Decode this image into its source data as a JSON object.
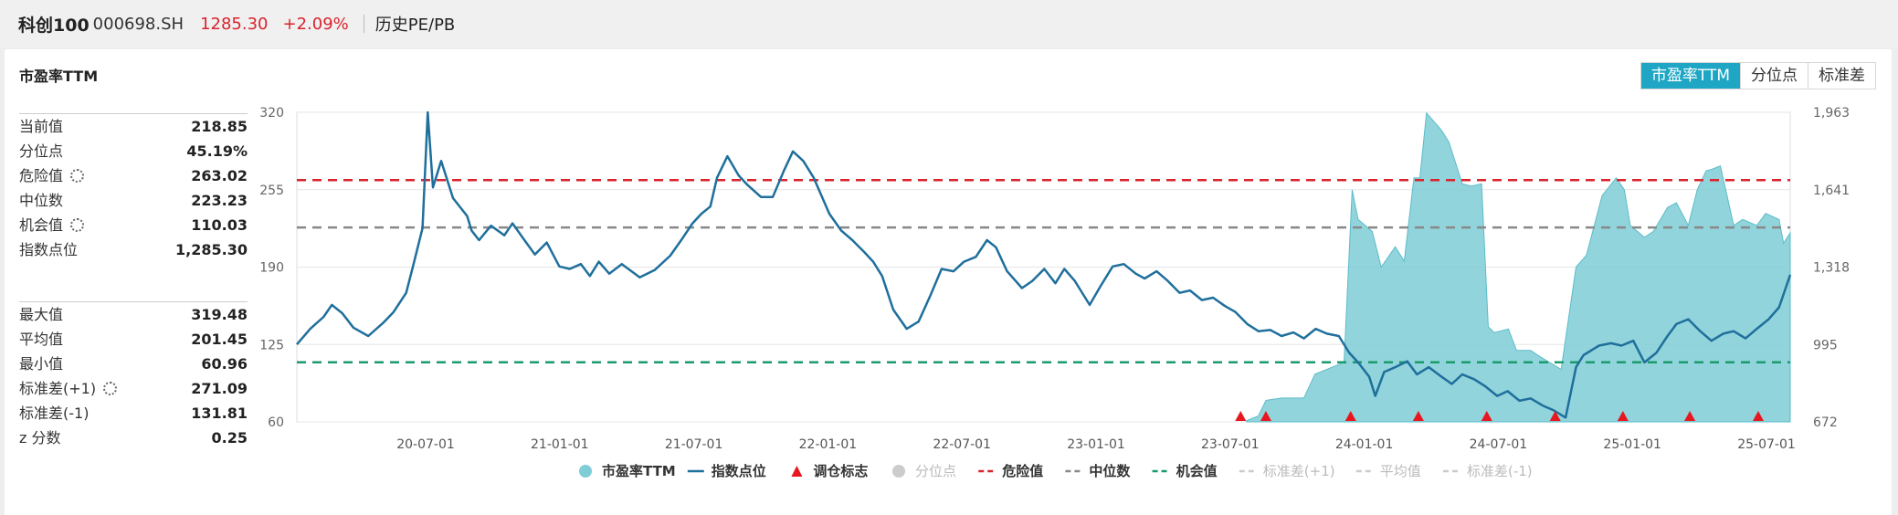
{
  "header": {
    "name": "科创100",
    "code": "000698.SH",
    "price": "1285.30",
    "change": "+2.09%",
    "tab": "历史PE/PB"
  },
  "panel": {
    "title": "市盈率TTM",
    "toggle": [
      "市盈率TTM",
      "分位点",
      "标准差"
    ],
    "active_toggle": 0
  },
  "stats_top": [
    {
      "label": "当前值",
      "value": "218.85",
      "gear": false
    },
    {
      "label": "分位点",
      "value": "45.19%",
      "gear": false
    },
    {
      "label": "危险值",
      "value": "263.02",
      "gear": true
    },
    {
      "label": "中位数",
      "value": "223.23",
      "gear": false
    },
    {
      "label": "机会值",
      "value": "110.03",
      "gear": true
    },
    {
      "label": "指数点位",
      "value": "1,285.30",
      "gear": false
    }
  ],
  "stats_bottom": [
    {
      "label": "最大值",
      "value": "319.48",
      "gear": false
    },
    {
      "label": "平均值",
      "value": "201.45",
      "gear": false
    },
    {
      "label": "最小值",
      "value": "60.96",
      "gear": false
    },
    {
      "label": "标准差(+1)",
      "value": "271.09",
      "gear": true
    },
    {
      "label": "标准差(-1)",
      "value": "131.81",
      "gear": false
    },
    {
      "label": "z 分数",
      "value": "0.25",
      "gear": false
    }
  ],
  "colors": {
    "pe_fill": "#7fcdd6",
    "pe_line": "#5bbcc9",
    "index_line": "#1f6f9c",
    "danger": "#d9232d",
    "median": "#888888",
    "opportunity": "#1a9b6c",
    "marker": "#e8161e",
    "grid": "#e6e6e6"
  },
  "chart_data": {
    "type": "line",
    "x_tick_labels": [
      "20-07-01",
      "21-01-01",
      "21-07-01",
      "22-01-01",
      "22-07-01",
      "23-01-01",
      "23-07-01",
      "24-01-01",
      "24-07-01",
      "25-01-01",
      "25-07-01"
    ],
    "y_left_ticks": [
      "320",
      "255",
      "190",
      "125",
      "60"
    ],
    "y_left_lim": [
      60,
      320
    ],
    "y_right_ticks": [
      "1,963",
      "1,641",
      "1,318",
      "995",
      "672"
    ],
    "y_right_lim": [
      672,
      1963
    ],
    "x_range": [
      "2020-01-23",
      "2025-07-23"
    ],
    "ref_lines": [
      {
        "name": "危险值",
        "value": 263.02
      },
      {
        "name": "中位数",
        "value": 223.23
      },
      {
        "name": "机会值",
        "value": 110.03
      }
    ],
    "pe_series": {
      "name": "市盈率TTM",
      "points": [
        [
          "2023-07-23",
          60.96
        ],
        [
          "2023-08-08",
          65
        ],
        [
          "2023-08-18",
          78
        ],
        [
          "2023-09-08",
          80
        ],
        [
          "2023-10-08",
          80
        ],
        [
          "2023-10-23",
          100
        ],
        [
          "2023-12-01",
          110
        ],
        [
          "2023-12-12",
          255
        ],
        [
          "2023-12-20",
          230
        ],
        [
          "2024-01-08",
          220
        ],
        [
          "2024-01-20",
          190
        ],
        [
          "2024-02-08",
          207
        ],
        [
          "2024-02-20",
          195
        ],
        [
          "2024-03-04",
          265
        ],
        [
          "2024-03-12",
          265
        ],
        [
          "2024-03-21",
          319.48
        ],
        [
          "2024-04-10",
          305
        ],
        [
          "2024-04-20",
          295
        ],
        [
          "2024-05-08",
          260
        ],
        [
          "2024-05-20",
          258
        ],
        [
          "2024-06-03",
          260
        ],
        [
          "2024-06-12",
          140
        ],
        [
          "2024-06-20",
          135
        ],
        [
          "2024-07-09",
          138
        ],
        [
          "2024-07-20",
          120
        ],
        [
          "2024-08-08",
          120
        ],
        [
          "2024-08-20",
          115
        ],
        [
          "2024-09-18",
          104
        ],
        [
          "2024-10-08",
          190
        ],
        [
          "2024-10-22",
          200
        ],
        [
          "2024-11-12",
          250
        ],
        [
          "2024-12-01",
          265
        ],
        [
          "2024-12-12",
          255
        ],
        [
          "2024-12-20",
          225
        ],
        [
          "2025-01-08",
          215
        ],
        [
          "2025-01-20",
          220
        ],
        [
          "2025-02-08",
          240
        ],
        [
          "2025-02-20",
          244
        ],
        [
          "2025-03-08",
          225
        ],
        [
          "2025-03-20",
          255
        ],
        [
          "2025-04-01",
          271
        ],
        [
          "2025-04-08",
          272
        ],
        [
          "2025-04-20",
          275
        ],
        [
          "2025-05-08",
          225
        ],
        [
          "2025-05-20",
          230
        ],
        [
          "2025-06-08",
          225
        ],
        [
          "2025-06-20",
          235
        ],
        [
          "2025-07-08",
          230
        ],
        [
          "2025-07-14",
          210
        ],
        [
          "2025-07-23",
          218.85
        ]
      ]
    },
    "index_series": {
      "name": "指数点位",
      "points": [
        [
          "2020-01-23",
          995
        ],
        [
          "2020-02-10",
          1060
        ],
        [
          "2020-02-28",
          1110
        ],
        [
          "2020-03-10",
          1160
        ],
        [
          "2020-03-24",
          1125
        ],
        [
          "2020-04-08",
          1065
        ],
        [
          "2020-04-28",
          1030
        ],
        [
          "2020-05-18",
          1085
        ],
        [
          "2020-06-01",
          1130
        ],
        [
          "2020-06-18",
          1210
        ],
        [
          "2020-06-28",
          1330
        ],
        [
          "2020-07-10",
          1480
        ],
        [
          "2020-07-17",
          1963
        ],
        [
          "2020-07-24",
          1650
        ],
        [
          "2020-08-04",
          1760
        ],
        [
          "2020-08-20",
          1605
        ],
        [
          "2020-09-08",
          1530
        ],
        [
          "2020-09-14",
          1470
        ],
        [
          "2020-09-24",
          1430
        ],
        [
          "2020-10-10",
          1490
        ],
        [
          "2020-10-28",
          1450
        ],
        [
          "2020-11-08",
          1500
        ],
        [
          "2020-11-24",
          1430
        ],
        [
          "2020-12-08",
          1370
        ],
        [
          "2020-12-24",
          1420
        ],
        [
          "2021-01-10",
          1320
        ],
        [
          "2021-01-24",
          1310
        ],
        [
          "2021-02-08",
          1330
        ],
        [
          "2021-02-20",
          1280
        ],
        [
          "2021-03-04",
          1340
        ],
        [
          "2021-03-18",
          1290
        ],
        [
          "2021-04-04",
          1330
        ],
        [
          "2021-04-28",
          1275
        ],
        [
          "2021-05-18",
          1305
        ],
        [
          "2021-06-08",
          1365
        ],
        [
          "2021-06-24",
          1435
        ],
        [
          "2021-07-08",
          1500
        ],
        [
          "2021-07-20",
          1540
        ],
        [
          "2021-08-01",
          1570
        ],
        [
          "2021-08-10",
          1690
        ],
        [
          "2021-08-24",
          1780
        ],
        [
          "2021-09-08",
          1700
        ],
        [
          "2021-09-20",
          1660
        ],
        [
          "2021-10-08",
          1610
        ],
        [
          "2021-10-24",
          1610
        ],
        [
          "2021-11-08",
          1720
        ],
        [
          "2021-11-20",
          1800
        ],
        [
          "2021-12-04",
          1760
        ],
        [
          "2021-12-18",
          1690
        ],
        [
          "2022-01-08",
          1540
        ],
        [
          "2022-01-24",
          1470
        ],
        [
          "2022-02-08",
          1430
        ],
        [
          "2022-02-24",
          1380
        ],
        [
          "2022-03-08",
          1340
        ],
        [
          "2022-03-20",
          1280
        ],
        [
          "2022-04-04",
          1140
        ],
        [
          "2022-04-22",
          1060
        ],
        [
          "2022-05-08",
          1090
        ],
        [
          "2022-05-24",
          1200
        ],
        [
          "2022-06-08",
          1310
        ],
        [
          "2022-06-24",
          1300
        ],
        [
          "2022-07-08",
          1340
        ],
        [
          "2022-07-24",
          1360
        ],
        [
          "2022-08-08",
          1430
        ],
        [
          "2022-08-20",
          1400
        ],
        [
          "2022-09-04",
          1300
        ],
        [
          "2022-09-24",
          1230
        ],
        [
          "2022-10-08",
          1260
        ],
        [
          "2022-10-24",
          1310
        ],
        [
          "2022-11-08",
          1250
        ],
        [
          "2022-11-20",
          1310
        ],
        [
          "2022-12-04",
          1260
        ],
        [
          "2022-12-24",
          1160
        ],
        [
          "2023-01-08",
          1240
        ],
        [
          "2023-01-24",
          1320
        ],
        [
          "2023-02-08",
          1330
        ],
        [
          "2023-02-24",
          1290
        ],
        [
          "2023-03-08",
          1270
        ],
        [
          "2023-03-24",
          1300
        ],
        [
          "2023-04-08",
          1260
        ],
        [
          "2023-04-24",
          1210
        ],
        [
          "2023-05-08",
          1220
        ],
        [
          "2023-05-24",
          1180
        ],
        [
          "2023-06-08",
          1190
        ],
        [
          "2023-06-24",
          1155
        ],
        [
          "2023-07-08",
          1130
        ],
        [
          "2023-07-24",
          1080
        ],
        [
          "2023-08-08",
          1050
        ],
        [
          "2023-08-24",
          1055
        ],
        [
          "2023-09-08",
          1030
        ],
        [
          "2023-09-24",
          1045
        ],
        [
          "2023-10-08",
          1020
        ],
        [
          "2023-10-24",
          1060
        ],
        [
          "2023-11-08",
          1040
        ],
        [
          "2023-11-24",
          1030
        ],
        [
          "2023-12-08",
          960
        ],
        [
          "2023-12-20",
          920
        ],
        [
          "2024-01-04",
          860
        ],
        [
          "2024-01-12",
          780
        ],
        [
          "2024-01-24",
          880
        ],
        [
          "2024-02-08",
          900
        ],
        [
          "2024-02-24",
          925
        ],
        [
          "2024-03-08",
          870
        ],
        [
          "2024-03-24",
          900
        ],
        [
          "2024-04-08",
          865
        ],
        [
          "2024-04-24",
          830
        ],
        [
          "2024-05-08",
          870
        ],
        [
          "2024-05-24",
          850
        ],
        [
          "2024-06-08",
          820
        ],
        [
          "2024-06-24",
          780
        ],
        [
          "2024-07-08",
          800
        ],
        [
          "2024-07-24",
          760
        ],
        [
          "2024-08-08",
          770
        ],
        [
          "2024-08-24",
          740
        ],
        [
          "2024-09-08",
          720
        ],
        [
          "2024-09-24",
          690
        ],
        [
          "2024-10-08",
          900
        ],
        [
          "2024-10-18",
          950
        ],
        [
          "2024-11-08",
          990
        ],
        [
          "2024-11-24",
          1000
        ],
        [
          "2024-12-08",
          990
        ],
        [
          "2024-12-24",
          1010
        ],
        [
          "2025-01-08",
          920
        ],
        [
          "2025-01-24",
          960
        ],
        [
          "2025-02-08",
          1030
        ],
        [
          "2025-02-20",
          1080
        ],
        [
          "2025-03-08",
          1100
        ],
        [
          "2025-03-24",
          1050
        ],
        [
          "2025-04-08",
          1010
        ],
        [
          "2025-04-24",
          1040
        ],
        [
          "2025-05-08",
          1050
        ],
        [
          "2025-05-24",
          1020
        ],
        [
          "2025-06-08",
          1060
        ],
        [
          "2025-06-24",
          1100
        ],
        [
          "2025-07-08",
          1150
        ],
        [
          "2025-07-23",
          1285.3
        ]
      ]
    },
    "rebalance_markers": [
      "2023-07-15",
      "2023-08-18",
      "2023-12-10",
      "2024-03-10",
      "2024-06-10",
      "2024-09-10",
      "2024-12-10",
      "2025-03-10",
      "2025-06-10"
    ]
  },
  "legend": [
    {
      "label": "市盈率TTM",
      "kind": "dot",
      "color": "#7fcdd6",
      "active": true
    },
    {
      "label": "指数点位",
      "kind": "line",
      "color": "#1f6f9c",
      "active": true
    },
    {
      "label": "调仓标志",
      "kind": "triangle",
      "color": "#e8161e",
      "active": true
    },
    {
      "label": "分位点",
      "kind": "dot",
      "color": "#cccccc",
      "active": false
    },
    {
      "label": "危险值",
      "kind": "dash",
      "color": "#d9232d",
      "active": true
    },
    {
      "label": "中位数",
      "kind": "dash",
      "color": "#888888",
      "active": true
    },
    {
      "label": "机会值",
      "kind": "dash",
      "color": "#1a9b6c",
      "active": true
    },
    {
      "label": "标准差(+1)",
      "kind": "dash",
      "color": "#cccccc",
      "active": false
    },
    {
      "label": "平均值",
      "kind": "dash",
      "color": "#cccccc",
      "active": false
    },
    {
      "label": "标准差(-1)",
      "kind": "dash",
      "color": "#cccccc",
      "active": false
    }
  ]
}
